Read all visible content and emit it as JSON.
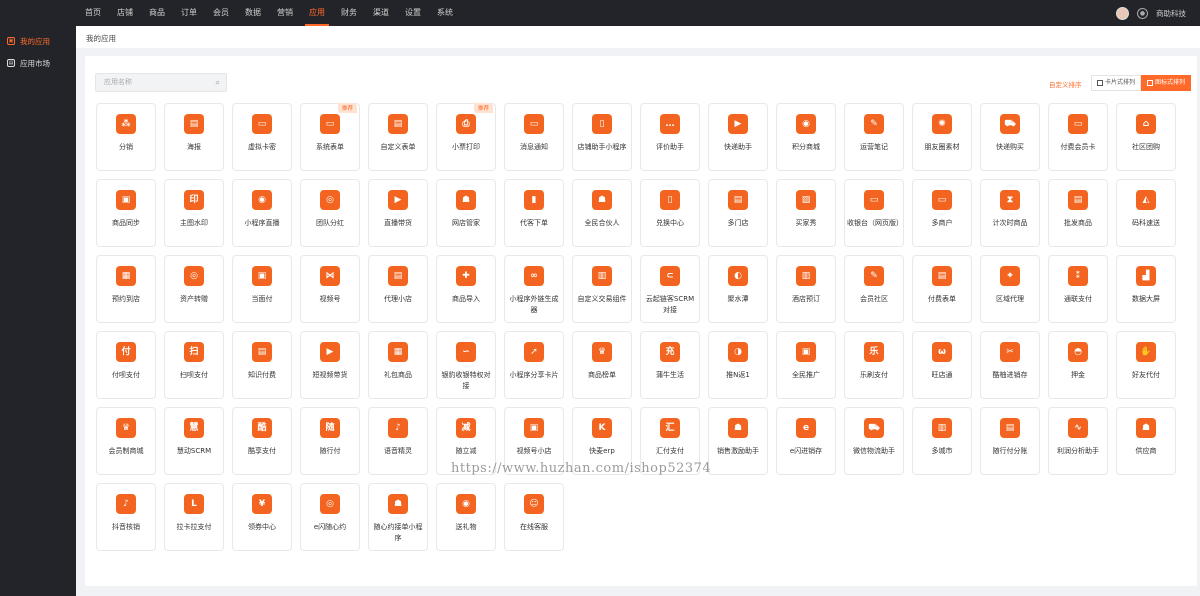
{
  "topbar": {
    "nav": [
      "首页",
      "店铺",
      "商品",
      "订单",
      "会员",
      "数据",
      "营销",
      "应用",
      "财务",
      "渠道",
      "设置",
      "系统"
    ],
    "active": "应用",
    "user": "商助科技",
    "bell_icon": "bell-icon"
  },
  "sidebar": {
    "items": [
      {
        "label": "我的应用",
        "icon": "app-icon",
        "active": true
      },
      {
        "label": "应用市场",
        "icon": "market-icon",
        "active": false
      }
    ]
  },
  "breadcrumb": "我的应用",
  "search": {
    "placeholder": "应用名称"
  },
  "toolbar": {
    "sort_label": "自定义排序",
    "card_view_label": "卡片式排列",
    "icon_view_label": "图标式排列"
  },
  "accent_color": "#f2641f",
  "apps": [
    {
      "label": "分销",
      "g": "⁂"
    },
    {
      "label": "海报",
      "g": "▤"
    },
    {
      "label": "虚拟卡密",
      "g": "▭"
    },
    {
      "label": "系统表单",
      "g": "▭",
      "tag": "推荐"
    },
    {
      "label": "自定义表单",
      "g": "▤"
    },
    {
      "label": "小票打印",
      "g": "⎙",
      "tag": "推荐"
    },
    {
      "label": "消息通知",
      "g": "▭"
    },
    {
      "label": "店铺助手小程序",
      "g": "▯"
    },
    {
      "label": "评价助手",
      "g": "…"
    },
    {
      "label": "快递助手",
      "g": "▶"
    },
    {
      "label": "积分商城",
      "g": "◉"
    },
    {
      "label": "运营笔记",
      "g": "✎"
    },
    {
      "label": "朋友圈素材",
      "g": "✺"
    },
    {
      "label": "快递购买",
      "g": "⛟"
    },
    {
      "label": "付费会员卡",
      "g": "▭"
    },
    {
      "label": "社区团购",
      "g": "⌂"
    },
    {
      "label": "商品同步",
      "g": "▣"
    },
    {
      "label": "主图水印",
      "g": "印"
    },
    {
      "label": "小程序直播",
      "g": "◉"
    },
    {
      "label": "团队分红",
      "g": "◎"
    },
    {
      "label": "直播带货",
      "g": "▶"
    },
    {
      "label": "网店管家",
      "g": "☗"
    },
    {
      "label": "代客下单",
      "g": "▮"
    },
    {
      "label": "全民合伙人",
      "g": "☗"
    },
    {
      "label": "兑换中心",
      "g": "▯"
    },
    {
      "label": "多门店",
      "g": "▤"
    },
    {
      "label": "买家秀",
      "g": "▨"
    },
    {
      "label": "收银台（网页版）",
      "g": "▭"
    },
    {
      "label": "多商户",
      "g": "▭"
    },
    {
      "label": "计次时商品",
      "g": "⧗"
    },
    {
      "label": "批发商品",
      "g": "▤"
    },
    {
      "label": "码科速送",
      "g": "◭"
    },
    {
      "label": "预约到店",
      "g": "▦"
    },
    {
      "label": "资产转赠",
      "g": "◎"
    },
    {
      "label": "当面付",
      "g": "▣"
    },
    {
      "label": "视频号",
      "g": "⋈"
    },
    {
      "label": "代理小店",
      "g": "▤"
    },
    {
      "label": "商品导入",
      "g": "✚"
    },
    {
      "label": "小程序外链生成器",
      "g": "∞"
    },
    {
      "label": "自定义交易组件",
      "g": "▥"
    },
    {
      "label": "云起链客SCRM对接",
      "g": "⊂"
    },
    {
      "label": "聚水潭",
      "g": "◐"
    },
    {
      "label": "酒店预订",
      "g": "▥"
    },
    {
      "label": "会员社区",
      "g": "✎"
    },
    {
      "label": "付费表单",
      "g": "▤"
    },
    {
      "label": "区域代理",
      "g": "⌖"
    },
    {
      "label": "通联支付",
      "g": "⁑"
    },
    {
      "label": "数据大屏",
      "g": "▟"
    },
    {
      "label": "付呗支付",
      "g": "付"
    },
    {
      "label": "扫呗支付",
      "g": "扫"
    },
    {
      "label": "知识付费",
      "g": "▤"
    },
    {
      "label": "短视频带货",
      "g": "▶"
    },
    {
      "label": "礼包商品",
      "g": "▦"
    },
    {
      "label": "银豹收银特权对接",
      "g": "∽"
    },
    {
      "label": "小程序分享卡片",
      "g": "➚"
    },
    {
      "label": "商品榜单",
      "g": "♛"
    },
    {
      "label": "蒲牛生活",
      "g": "充"
    },
    {
      "label": "推N返1",
      "g": "◑"
    },
    {
      "label": "全民推广",
      "g": "▣"
    },
    {
      "label": "乐刷支付",
      "g": "乐"
    },
    {
      "label": "旺店通",
      "g": "ω"
    },
    {
      "label": "酷柚进销存",
      "g": "✂"
    },
    {
      "label": "押金",
      "g": "◓"
    },
    {
      "label": "好友代付",
      "g": "✋"
    },
    {
      "label": "会员制商城",
      "g": "♛"
    },
    {
      "label": "慧动SCRM",
      "g": "慧"
    },
    {
      "label": "酷享支付",
      "g": "酷"
    },
    {
      "label": "随行付",
      "g": "随"
    },
    {
      "label": "语音精灵",
      "g": "♪"
    },
    {
      "label": "随立减",
      "g": "减"
    },
    {
      "label": "视频号小店",
      "g": "▣"
    },
    {
      "label": "快麦erp",
      "g": "K"
    },
    {
      "label": "汇付支付",
      "g": "汇"
    },
    {
      "label": "销售激励助手",
      "g": "☗"
    },
    {
      "label": "e闪进销存",
      "g": "e"
    },
    {
      "label": "微信物流助手",
      "g": "⛟"
    },
    {
      "label": "多城市",
      "g": "▥"
    },
    {
      "label": "随行付分账",
      "g": "▤"
    },
    {
      "label": "利润分析助手",
      "g": "∿"
    },
    {
      "label": "供应商",
      "g": "☗"
    },
    {
      "label": "抖音核销",
      "g": "♪"
    },
    {
      "label": "拉卡拉支付",
      "g": "L"
    },
    {
      "label": "领券中心",
      "g": "¥"
    },
    {
      "label": "e闪随心约",
      "g": "◎"
    },
    {
      "label": "随心约接单小程序",
      "g": "☗"
    },
    {
      "label": "送礼物",
      "g": "◉"
    },
    {
      "label": "在线客服",
      "g": "☺"
    }
  ],
  "watermark": "https://www.huzhan.com/ishop52374"
}
